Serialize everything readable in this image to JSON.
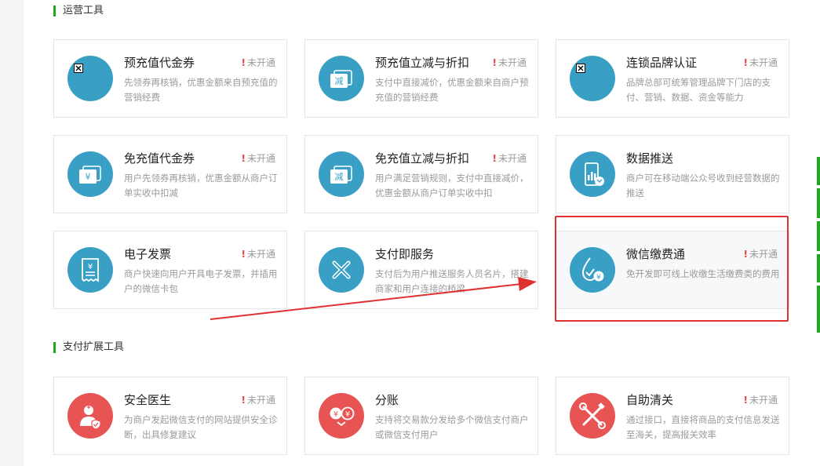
{
  "sections": {
    "ops_title": "运营工具",
    "ext_title": "支付扩展工具"
  },
  "cards": [
    {
      "title": "预充值代金券",
      "status_mark": "!",
      "status": "未开通",
      "desc": "先领券再核销，优惠金额来自预充值的营销经费",
      "icon": "broken-image-icon",
      "color": "#3a9fc5"
    },
    {
      "title": "预充值立减与折扣",
      "status_mark": "!",
      "status": "未开通",
      "desc": "支付中直接减价，优惠金额来自商户预充值的营销经费",
      "icon": "discount-ticket-icon",
      "color": "#3a9fc5"
    },
    {
      "title": "连锁品牌认证",
      "status_mark": "!",
      "status": "未开通",
      "desc": "品牌总部可统筹管理品牌下门店的支付、营销、数据、资金等能力",
      "icon": "broken-image-icon",
      "color": "#3a9fc5"
    },
    {
      "title": "免充值代金券",
      "status_mark": "!",
      "status": "未开通",
      "desc": "用户先领券再核销，优惠金额从商户订单实收中扣减",
      "icon": "yuan-ticket-icon",
      "color": "#3a9fc5"
    },
    {
      "title": "免充值立减与折扣",
      "status_mark": "!",
      "status": "未开通",
      "desc": "用户满足营销规则，支付中直接减价，优惠金额从商户订单实收中扣",
      "icon": "discount-ticket-icon",
      "color": "#3a9fc5"
    },
    {
      "title": "数据推送",
      "status_mark": "",
      "status": "",
      "desc": "商户可在移动端公众号收到经营数据的推送",
      "icon": "phone-chart-icon",
      "color": "#3a9fc5"
    },
    {
      "title": "电子发票",
      "status_mark": "!",
      "status": "未开通",
      "desc": "商户快速向用户开具电子发票，并插用户的微信卡包",
      "icon": "invoice-icon",
      "color": "#3a9fc5"
    },
    {
      "title": "支付即服务",
      "status_mark": "",
      "status": "",
      "desc": "支付后为用户推送服务人员名片，搭建商家和用户连接的桥梁",
      "icon": "service-link-icon",
      "color": "#3a9fc5"
    },
    {
      "title": "微信缴费通",
      "status_mark": "!",
      "status": "未开通",
      "desc": "免开发即可线上收缴生活缴费类的费用",
      "icon": "water-drop-yuan-icon",
      "color": "#3a9fc5"
    },
    {
      "title": "安全医生",
      "status_mark": "!",
      "status": "未开通",
      "desc": "为商户发起微信支付的网站提供安全诊断，出具修复建议",
      "icon": "doctor-icon",
      "color": "#e85454"
    },
    {
      "title": "分账",
      "status_mark": "",
      "status": "",
      "desc": "支持将交易款分发给多个微信支付商户或微信支付用户",
      "icon": "split-yuan-icon",
      "color": "#e85454"
    },
    {
      "title": "自助清关",
      "status_mark": "!",
      "status": "未开通",
      "desc": "通过接口，直接将商品的支付信息发送至海关，提高报关效率",
      "icon": "customs-tools-icon",
      "color": "#e85454"
    }
  ],
  "colors": {
    "accent_green": "#1aad19",
    "icon_blue": "#3a9fc5",
    "icon_red": "#e85454",
    "annotation_red": "#e03131"
  }
}
